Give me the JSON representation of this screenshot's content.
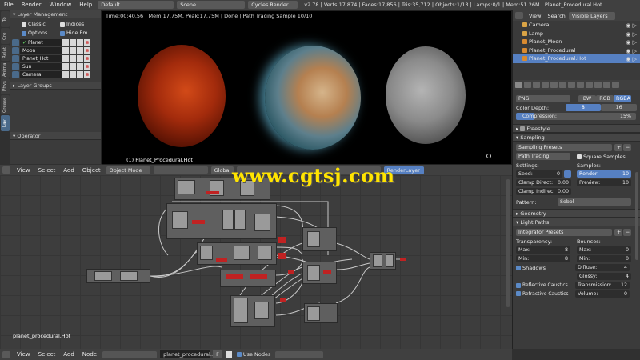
{
  "topbar": {
    "menus": [
      "File",
      "Render",
      "Window",
      "Help"
    ],
    "screen_layout": "Default",
    "scene": "Scene",
    "engine": "Cycles Render",
    "stats": "v2.78 | Verts:17,874 | Faces:17,856 | Tris:35,712 | Objects:1/13 | Lamps:0/1 | Mem:51.26M | Planet_Procedural.Hot"
  },
  "left_tabs": [
    "To",
    "Cre",
    "Relat",
    "Anima",
    "Phys",
    "Grease P",
    "Lay"
  ],
  "layer_panel": {
    "title": "Layer Management",
    "classic_label": "Classic",
    "indices_label": "Indices",
    "options_label": "Options",
    "hide_empty_label": "Hide Em...",
    "layers": [
      "Planet",
      "Moon",
      "Planet_Hot",
      "Sun",
      "Camera"
    ],
    "layer_groups_label": "Layer Groups",
    "operator_label": "Operator"
  },
  "render": {
    "info": "Time:00:40.56 | Mem:17.75M, Peak:17.75M | Done | Path Tracing Sample 10/10",
    "object_label": "(1) Planet_Procedural.Hot"
  },
  "node_header": {
    "menus": [
      "View",
      "Select",
      "Add",
      "Object"
    ],
    "mode": "Object Mode",
    "global": "Global",
    "render_layer": "RenderLayer"
  },
  "node_editor": {
    "tree_name": "planet_procedural.Hot"
  },
  "bottombar": {
    "menus": [
      "View",
      "Select",
      "Add",
      "Node"
    ],
    "material": "planet_procedural...",
    "fake_user": "F",
    "use_nodes": "Use Nodes"
  },
  "outliner": {
    "menus": [
      "View",
      "Search"
    ],
    "filter": "Visible Layers",
    "items": [
      "Camera",
      "Lamp",
      "Planet_Moon",
      "Planet_Procedural",
      "Planet_Procedural.Hot"
    ]
  },
  "properties": {
    "format": "PNG",
    "bw": "BW",
    "rgb": "RGB",
    "rgba": "RGBA",
    "color_depth_label": "Color Depth:",
    "depth_8": "8",
    "depth_16": "16",
    "compression_label": "Compression:",
    "compression_value": "15%",
    "compression_fraction": 0.15,
    "freestyle_label": "Freestyle",
    "sampling_label": "Sampling",
    "sampling_presets": "Sampling Presets",
    "integrator": "Path Tracing",
    "square_samples": "Square Samples",
    "settings_label": "Settings:",
    "samples_label": "Samples:",
    "seed_label": "Seed:",
    "seed_value": "0",
    "render_label": "Render:",
    "render_value": "10",
    "clamp_direct_label": "Clamp Direct:",
    "clamp_direct_value": "0.00",
    "preview_label": "Preview:",
    "preview_value": "10",
    "clamp_indirect_label": "Clamp Indirec:",
    "clamp_indirect_value": "0.00",
    "pattern_label": "Pattern:",
    "pattern_value": "Sobol",
    "geometry_label": "Geometry",
    "light_paths_label": "Light Paths",
    "integrator_presets": "Integrator Presets",
    "transparency_label": "Transparency:",
    "bounces_label": "Bounces:",
    "t_max_label": "Max:",
    "t_max_value": "8",
    "t_min_label": "Min:",
    "t_min_value": "8",
    "b_max_label": "Max:",
    "b_max_value": "0",
    "b_min_label": "Min:",
    "b_min_value": "0",
    "shadows_label": "Shadows",
    "diffuse_label": "Diffuse:",
    "diffuse_value": "4",
    "glossy_label": "Glossy:",
    "glossy_value": "4",
    "refl_caustics_label": "Reflective Caustics",
    "refr_caustics_label": "Refractive Caustics",
    "transmission_label": "Transmission:",
    "transmission_value": "12",
    "volume_label": "Volume:",
    "volume_value": "0"
  },
  "watermark": "www.cgtsj.com"
}
